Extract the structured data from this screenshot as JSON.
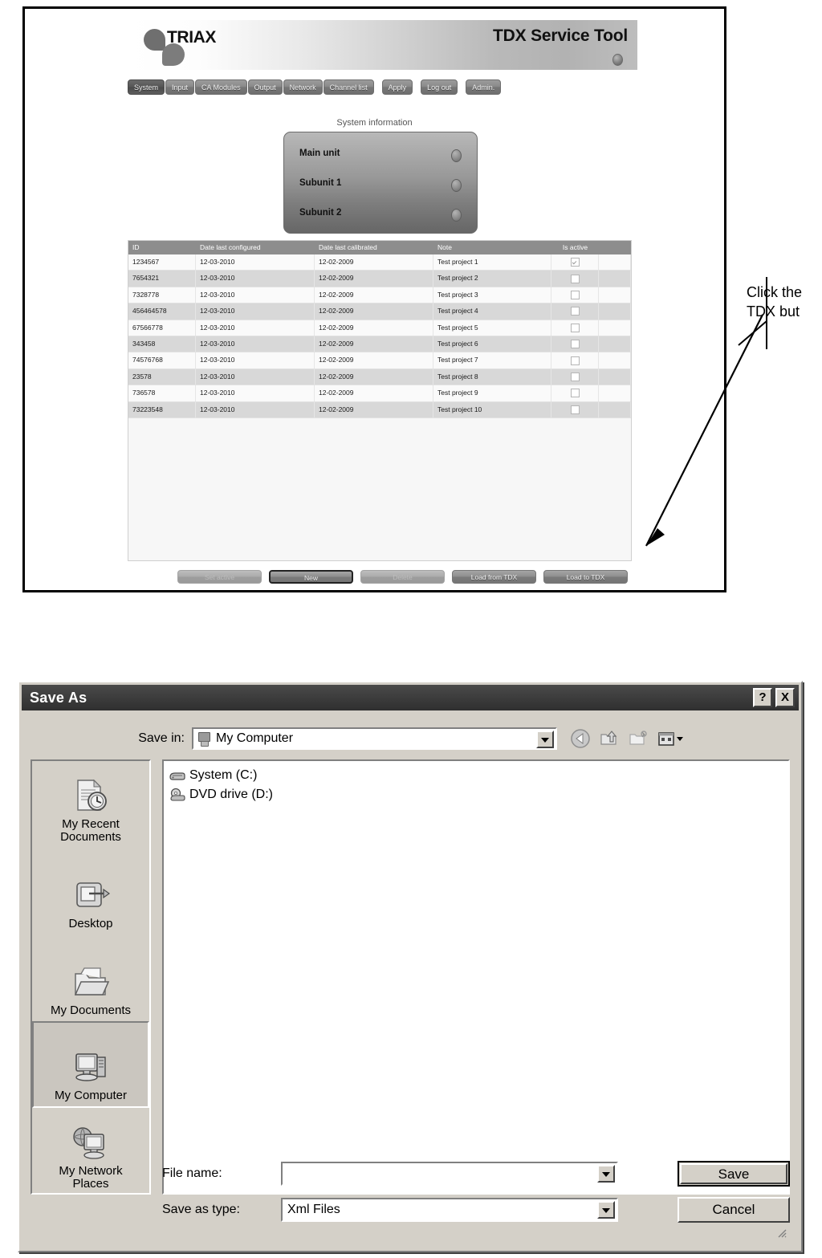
{
  "tdx": {
    "brand": "TRIAX",
    "app_title": "TDX Service Tool",
    "menu": [
      {
        "label": "System",
        "active": true
      },
      {
        "label": "Input",
        "active": false
      },
      {
        "label": "CA Modules",
        "active": false
      },
      {
        "label": "Output",
        "active": false
      },
      {
        "label": "Network",
        "active": false
      },
      {
        "label": "Channel list",
        "active": false
      },
      {
        "label": "Apply",
        "active": false,
        "gap": true
      },
      {
        "label": "Log out",
        "active": false,
        "gap": true
      },
      {
        "label": "Admin.",
        "active": false,
        "gap": true
      }
    ],
    "system_information": {
      "title": "System information",
      "rows": [
        {
          "label": "Main unit"
        },
        {
          "label": "Subunit 1"
        },
        {
          "label": "Subunit 2"
        }
      ]
    },
    "table": {
      "headers": [
        "ID",
        "Date last configured",
        "Date last calibrated",
        "Note",
        "Is active",
        ""
      ],
      "rows": [
        {
          "id": "1234567",
          "configured": "12-03-2010",
          "calibrated": "12-02-2009",
          "note": "Test project 1",
          "is_active": true
        },
        {
          "id": "7654321",
          "configured": "12-03-2010",
          "calibrated": "12-02-2009",
          "note": "Test project 2",
          "is_active": false
        },
        {
          "id": "7328778",
          "configured": "12-03-2010",
          "calibrated": "12-02-2009",
          "note": "Test project 3",
          "is_active": false
        },
        {
          "id": "456464578",
          "configured": "12-03-2010",
          "calibrated": "12-02-2009",
          "note": "Test project 4",
          "is_active": false
        },
        {
          "id": "67566778",
          "configured": "12-03-2010",
          "calibrated": "12-02-2009",
          "note": "Test project 5",
          "is_active": false
        },
        {
          "id": "343458",
          "configured": "12-03-2010",
          "calibrated": "12-02-2009",
          "note": "Test project 6",
          "is_active": false
        },
        {
          "id": "74576768",
          "configured": "12-03-2010",
          "calibrated": "12-02-2009",
          "note": "Test project 7",
          "is_active": false
        },
        {
          "id": "23578",
          "configured": "12-03-2010",
          "calibrated": "12-02-2009",
          "note": "Test project 8",
          "is_active": false
        },
        {
          "id": "736578",
          "configured": "12-03-2010",
          "calibrated": "12-02-2009",
          "note": "Test project 9",
          "is_active": false
        },
        {
          "id": "73223548",
          "configured": "12-03-2010",
          "calibrated": "12-02-2009",
          "note": "Test project 10",
          "is_active": false
        }
      ]
    },
    "buttons": [
      {
        "label": "Set active",
        "state": "disabled"
      },
      {
        "label": "New",
        "state": "focused"
      },
      {
        "label": "Delete",
        "state": "disabled"
      },
      {
        "label": "Load from TDX",
        "state": "normal"
      },
      {
        "label": "Load to TDX",
        "state": "normal"
      }
    ]
  },
  "callout": {
    "line1": "Click the",
    "line2": "TDX but"
  },
  "save_as": {
    "title": "Save As",
    "help_label": "?",
    "close_label": "X",
    "save_in_label": "Save in:",
    "save_in_value": "My Computer",
    "toolbar": [
      "back-icon",
      "up-one-level-icon",
      "new-folder-icon",
      "views-icon"
    ],
    "places": [
      {
        "label": "My Recent\nDocuments",
        "icon": "recent-documents-icon",
        "selected": false
      },
      {
        "label": "Desktop",
        "icon": "desktop-icon",
        "selected": false
      },
      {
        "label": "My Documents",
        "icon": "my-documents-icon",
        "selected": false
      },
      {
        "label": "My Computer",
        "icon": "my-computer-icon",
        "selected": true
      },
      {
        "label": "My Network\nPlaces",
        "icon": "my-network-places-icon",
        "selected": false
      }
    ],
    "files": [
      {
        "label": "System (C:)",
        "icon": "hard-disk-icon"
      },
      {
        "label": "DVD drive (D:)",
        "icon": "dvd-drive-icon"
      }
    ],
    "file_name_label": "File name:",
    "file_name_value": "",
    "save_as_type_label": "Save as type:",
    "save_as_type_value": "Xml Files",
    "save_button": "Save",
    "cancel_button": "Cancel"
  }
}
